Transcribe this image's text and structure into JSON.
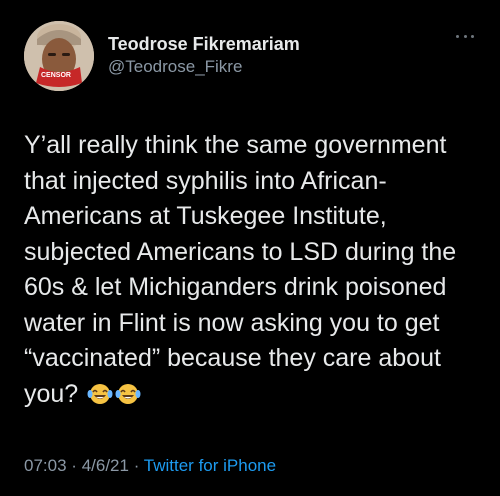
{
  "user": {
    "display_name": "Teodrose Fikremariam",
    "handle": "@Teodrose_Fikre",
    "avatar_badge": "CENSOR"
  },
  "tweet": {
    "text": "Y’all really think the same government that injected syphilis into African-Americans at Tuskegee Institute, subjected Americans to LSD during the 60s & let Michiganders drink poisoned water in Flint is now asking you to get “vaccinated” because they care about you?",
    "emojis": [
      "laughing-crying-emoji",
      "laughing-crying-emoji"
    ]
  },
  "meta": {
    "time": "07:03",
    "separator": "·",
    "date": "4/6/21",
    "source": "Twitter for iPhone"
  },
  "icons": {
    "more": "more-dots-icon"
  },
  "colors": {
    "background": "#000000",
    "text": "#e7e9ea",
    "secondary": "#8b98a5",
    "link": "#1d9bf0"
  }
}
